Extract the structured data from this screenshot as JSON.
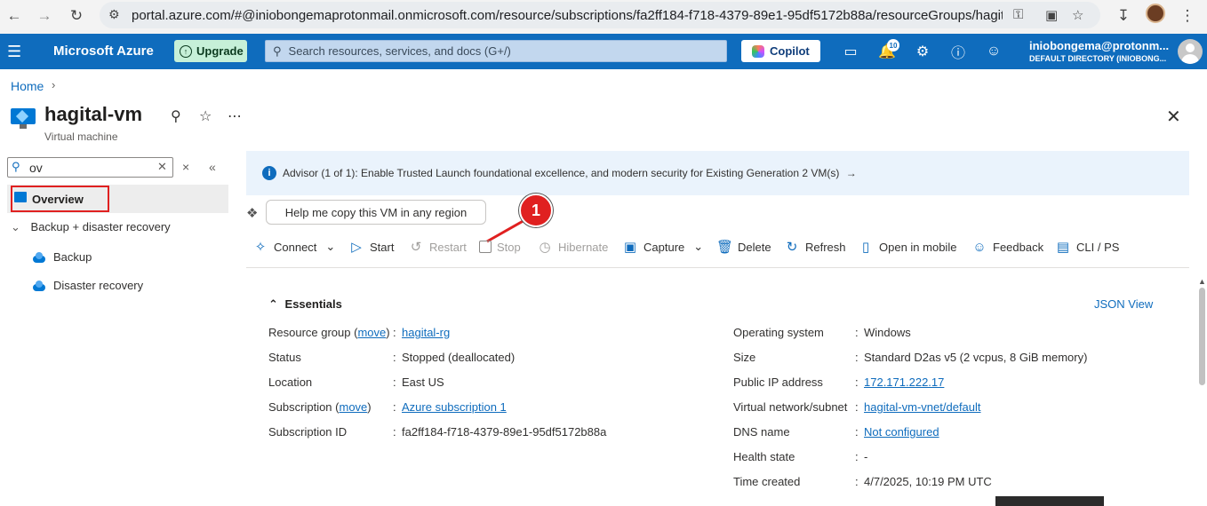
{
  "browser": {
    "url": "portal.azure.com/#@iniobongemaprotonmail.onmicrosoft.com/resource/subscriptions/fa2ff184-f718-4379-89e1-95df5172b88a/resourceGroups/hagital-rg/p..."
  },
  "header": {
    "brand": "Microsoft Azure",
    "upgrade_label": "Upgrade",
    "search_placeholder": "Search resources, services, and docs (G+/)",
    "copilot_label": "Copilot",
    "notifications_count": "10",
    "user_name": "iniobongema@protonm...",
    "user_directory": "DEFAULT DIRECTORY (INIOBONG..."
  },
  "breadcrumb": {
    "home": "Home"
  },
  "resource": {
    "name": "hagital-vm",
    "type": "Virtual machine"
  },
  "sidebar": {
    "filter_value": "ov",
    "overview": "Overview",
    "group": "Backup + disaster recovery",
    "items": [
      "Backup",
      "Disaster recovery"
    ]
  },
  "advisor": {
    "text": "Advisor (1 of 1): Enable Trusted Launch foundational excellence, and modern security for Existing Generation 2 VM(s)"
  },
  "copilot_prompt": "Help me copy this VM in any region",
  "callout_number": "1",
  "commands": {
    "connect": "Connect",
    "start": "Start",
    "restart": "Restart",
    "stop": "Stop",
    "hibernate": "Hibernate",
    "capture": "Capture",
    "delete": "Delete",
    "refresh": "Refresh",
    "open_mobile": "Open in mobile",
    "feedback": "Feedback",
    "cli": "CLI / PS"
  },
  "essentials": {
    "title": "Essentials",
    "json_view": "JSON View",
    "left": {
      "resource_group_label": "Resource group",
      "move": "move",
      "resource_group": "hagital-rg",
      "status_label": "Status",
      "status": "Stopped (deallocated)",
      "location_label": "Location",
      "location": "East US",
      "subscription_label": "Subscription",
      "subscription": "Azure subscription 1",
      "subscription_id_label": "Subscription ID",
      "subscription_id": "fa2ff184-f718-4379-89e1-95df5172b88a"
    },
    "right": {
      "os_label": "Operating system",
      "os": "Windows",
      "size_label": "Size",
      "size": "Standard D2as v5 (2 vcpus, 8 GiB memory)",
      "public_ip_label": "Public IP address",
      "public_ip": "172.171.222.17",
      "vnet_label": "Virtual network/subnet",
      "vnet": "hagital-vm-vnet/default",
      "dns_label": "DNS name",
      "dns": "Not configured",
      "health_label": "Health state",
      "health": "-",
      "created_label": "Time created",
      "created": "4/7/2025, 10:19 PM UTC"
    }
  }
}
